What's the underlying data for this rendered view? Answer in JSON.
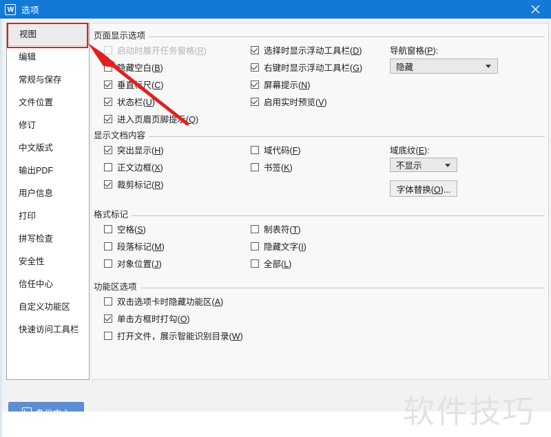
{
  "window": {
    "title": "选项",
    "app_icon": "wps-writer-icon",
    "close_label": "×",
    "titlebar_color": "#1379d6"
  },
  "sidebar": {
    "selected_index": 0,
    "items": [
      {
        "label": "视图"
      },
      {
        "label": "编辑"
      },
      {
        "label": "常规与保存"
      },
      {
        "label": "文件位置"
      },
      {
        "label": "修订"
      },
      {
        "label": "中文版式"
      },
      {
        "label": "输出PDF"
      },
      {
        "label": "用户信息"
      },
      {
        "label": "打印"
      },
      {
        "label": "拼写检查"
      },
      {
        "label": "安全性"
      },
      {
        "label": "信任中心"
      },
      {
        "label": "自定义功能区"
      },
      {
        "label": "快速访问工具栏"
      }
    ],
    "backup_button": {
      "label": "备份中心",
      "icon": "backup-document-icon",
      "color": "#5b8fd0"
    }
  },
  "groups": {
    "page_display": {
      "title": "页面显示选项",
      "left_column": [
        {
          "text": "启动时展开任务窗格",
          "mnemonic": "R",
          "checked": false,
          "disabled": true
        },
        {
          "text": "隐藏空白",
          "mnemonic": "B",
          "checked": false,
          "disabled": false
        },
        {
          "text": "垂直标尺",
          "mnemonic": "C",
          "checked": true,
          "disabled": false
        },
        {
          "text": "状态栏",
          "mnemonic": "U",
          "checked": true,
          "disabled": false
        },
        {
          "text": "进入页眉页脚提示",
          "mnemonic": "Q",
          "checked": true,
          "disabled": false
        }
      ],
      "right_column": [
        {
          "text": "选择时显示浮动工具栏",
          "mnemonic": "D",
          "checked": true,
          "disabled": false
        },
        {
          "text": "右键时显示浮动工具栏",
          "mnemonic": "G",
          "checked": true,
          "disabled": false
        },
        {
          "text": "屏幕提示",
          "mnemonic": "N",
          "checked": true,
          "disabled": false
        },
        {
          "text": "启用实时预览",
          "mnemonic": "V",
          "checked": true,
          "disabled": false
        }
      ],
      "navigation_pane": {
        "label": "导航窗格",
        "mnemonic": "P",
        "value": "隐藏"
      }
    },
    "document_content": {
      "title": "显示文档内容",
      "left_column": [
        {
          "text": "突出显示",
          "mnemonic": "H",
          "checked": true,
          "disabled": false
        },
        {
          "text": "正文边框",
          "mnemonic": "X",
          "checked": false,
          "disabled": false
        },
        {
          "text": "裁剪标记",
          "mnemonic": "R",
          "checked": true,
          "disabled": false
        }
      ],
      "right_column": [
        {
          "text": "域代码",
          "mnemonic": "F",
          "checked": false,
          "disabled": false
        },
        {
          "text": "书签",
          "mnemonic": "K",
          "checked": false,
          "disabled": false
        }
      ],
      "field_shading": {
        "label": "域底纹",
        "mnemonic": "E",
        "value": "不显示"
      },
      "font_substitution_button": {
        "text": "字体替换",
        "mnemonic": "O",
        "suffix": "..."
      }
    },
    "format_marks": {
      "title": "格式标记",
      "left_column": [
        {
          "text": "空格",
          "mnemonic": "S",
          "checked": false,
          "disabled": false
        },
        {
          "text": "段落标记",
          "mnemonic": "M",
          "checked": false,
          "disabled": false
        },
        {
          "text": "对象位置",
          "mnemonic": "J",
          "checked": false,
          "disabled": false
        }
      ],
      "right_column": [
        {
          "text": "制表符",
          "mnemonic": "T",
          "checked": false,
          "disabled": false
        },
        {
          "text": "隐藏文字",
          "mnemonic": "I",
          "checked": false,
          "disabled": false
        },
        {
          "text": "全部",
          "mnemonic": "L",
          "checked": false,
          "disabled": false
        }
      ]
    },
    "ribbon_options": {
      "title": "功能区选项",
      "left_column": [
        {
          "text": "双击选项卡时隐藏功能区",
          "mnemonic": "A",
          "checked": false,
          "disabled": false
        },
        {
          "text": "单击方框时打勾",
          "mnemonic": "O",
          "checked": true,
          "disabled": false
        },
        {
          "text": "打开文件，展示智能识别目录",
          "mnemonic": "W",
          "checked": false,
          "disabled": false
        }
      ]
    }
  },
  "annotations": {
    "arrow_color": "#e02020",
    "highlight_color": "#e02020",
    "watermark": "软件技巧"
  }
}
